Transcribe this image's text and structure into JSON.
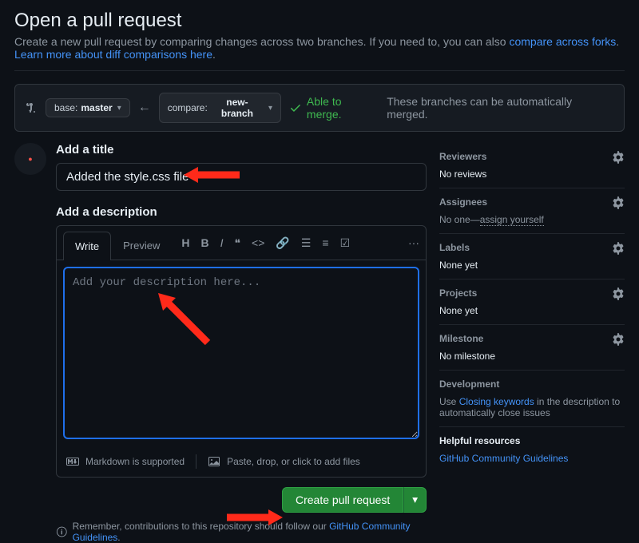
{
  "header": {
    "title": "Open a pull request",
    "subtitle_prefix": "Create a new pull request by comparing changes across two branches. If you need to, you can also ",
    "link_compare": "compare across forks",
    "link_learn": "Learn more about diff comparisons here"
  },
  "branch": {
    "base_prefix": "base: ",
    "base_value": "master",
    "compare_prefix": "compare: ",
    "compare_value": "new-branch",
    "merge_ok": "Able to merge.",
    "merge_sub": "These branches can be automatically merged."
  },
  "form": {
    "title_label": "Add a title",
    "title_value": "Added the style.css file",
    "desc_label": "Add a description",
    "tab_write": "Write",
    "tab_preview": "Preview",
    "desc_placeholder": "Add your description here...",
    "md_supported": "Markdown is supported",
    "paste_hint": "Paste, drop, or click to add files",
    "create_label": "Create pull request",
    "remember_prefix": "Remember, contributions to this repository should follow our ",
    "remember_link": "GitHub Community Guidelines"
  },
  "sidebar": {
    "reviewers": {
      "label": "Reviewers",
      "value": "No reviews"
    },
    "assignees": {
      "label": "Assignees",
      "value_prefix": "No one—",
      "link": "assign yourself"
    },
    "labels": {
      "label": "Labels",
      "value": "None yet"
    },
    "projects": {
      "label": "Projects",
      "value": "None yet"
    },
    "milestone": {
      "label": "Milestone",
      "value": "No milestone"
    },
    "development": {
      "label": "Development",
      "text_prefix": "Use ",
      "link": "Closing keywords",
      "text_suffix": " in the description to automatically close issues"
    },
    "helpful": {
      "label": "Helpful resources",
      "link": "GitHub Community Guidelines"
    }
  },
  "period": "."
}
